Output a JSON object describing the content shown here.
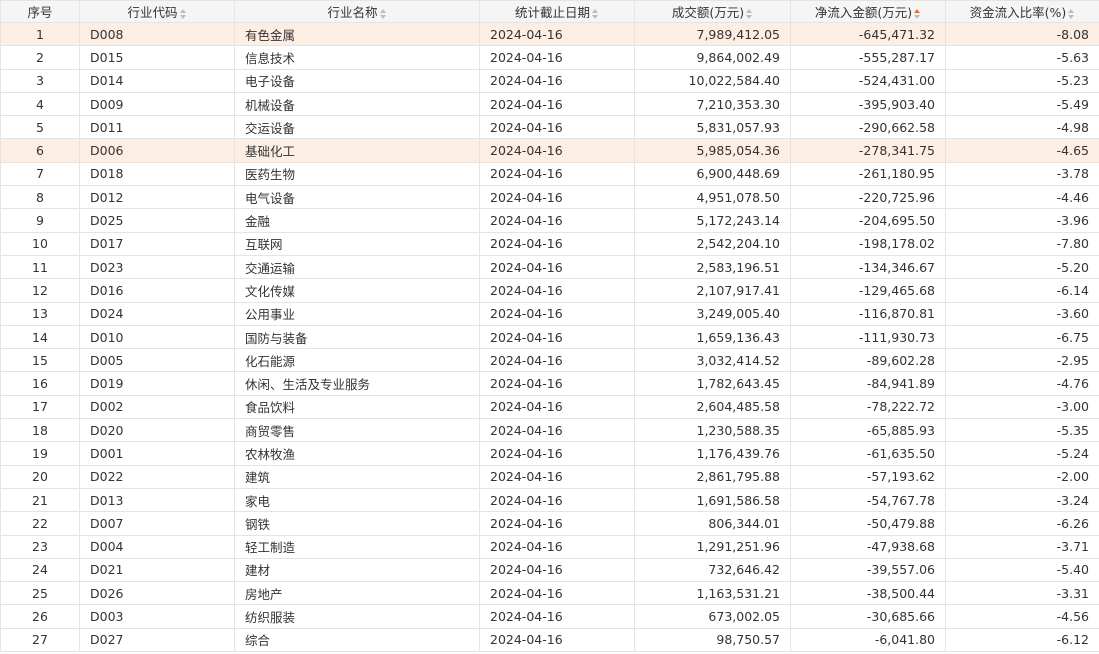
{
  "columns": {
    "seq": "序号",
    "code": "行业代码",
    "name": "行业名称",
    "date": "统计截止日期",
    "turnover": "成交额(万元)",
    "netflow": "净流入金额(万元)",
    "ratio": "资金流入比率(%)"
  },
  "sort": {
    "active_column": "netflow",
    "direction": "ascending",
    "active_color": "#f26b21"
  },
  "highlight_color": "#fdeee4",
  "rows": [
    {
      "seq": "1",
      "code": "D008",
      "name": "有色金属",
      "date": "2024-04-16",
      "turnover": "7,989,412.05",
      "netflow": "-645,471.32",
      "ratio": "-8.08",
      "highlighted": true
    },
    {
      "seq": "2",
      "code": "D015",
      "name": "信息技术",
      "date": "2024-04-16",
      "turnover": "9,864,002.49",
      "netflow": "-555,287.17",
      "ratio": "-5.63",
      "highlighted": false
    },
    {
      "seq": "3",
      "code": "D014",
      "name": "电子设备",
      "date": "2024-04-16",
      "turnover": "10,022,584.40",
      "netflow": "-524,431.00",
      "ratio": "-5.23",
      "highlighted": false
    },
    {
      "seq": "4",
      "code": "D009",
      "name": "机械设备",
      "date": "2024-04-16",
      "turnover": "7,210,353.30",
      "netflow": "-395,903.40",
      "ratio": "-5.49",
      "highlighted": false
    },
    {
      "seq": "5",
      "code": "D011",
      "name": "交运设备",
      "date": "2024-04-16",
      "turnover": "5,831,057.93",
      "netflow": "-290,662.58",
      "ratio": "-4.98",
      "highlighted": false
    },
    {
      "seq": "6",
      "code": "D006",
      "name": "基础化工",
      "date": "2024-04-16",
      "turnover": "5,985,054.36",
      "netflow": "-278,341.75",
      "ratio": "-4.65",
      "highlighted": true
    },
    {
      "seq": "7",
      "code": "D018",
      "name": "医药生物",
      "date": "2024-04-16",
      "turnover": "6,900,448.69",
      "netflow": "-261,180.95",
      "ratio": "-3.78",
      "highlighted": false
    },
    {
      "seq": "8",
      "code": "D012",
      "name": "电气设备",
      "date": "2024-04-16",
      "turnover": "4,951,078.50",
      "netflow": "-220,725.96",
      "ratio": "-4.46",
      "highlighted": false
    },
    {
      "seq": "9",
      "code": "D025",
      "name": "金融",
      "date": "2024-04-16",
      "turnover": "5,172,243.14",
      "netflow": "-204,695.50",
      "ratio": "-3.96",
      "highlighted": false
    },
    {
      "seq": "10",
      "code": "D017",
      "name": "互联网",
      "date": "2024-04-16",
      "turnover": "2,542,204.10",
      "netflow": "-198,178.02",
      "ratio": "-7.80",
      "highlighted": false
    },
    {
      "seq": "11",
      "code": "D023",
      "name": "交通运输",
      "date": "2024-04-16",
      "turnover": "2,583,196.51",
      "netflow": "-134,346.67",
      "ratio": "-5.20",
      "highlighted": false
    },
    {
      "seq": "12",
      "code": "D016",
      "name": "文化传媒",
      "date": "2024-04-16",
      "turnover": "2,107,917.41",
      "netflow": "-129,465.68",
      "ratio": "-6.14",
      "highlighted": false
    },
    {
      "seq": "13",
      "code": "D024",
      "name": "公用事业",
      "date": "2024-04-16",
      "turnover": "3,249,005.40",
      "netflow": "-116,870.81",
      "ratio": "-3.60",
      "highlighted": false
    },
    {
      "seq": "14",
      "code": "D010",
      "name": "国防与装备",
      "date": "2024-04-16",
      "turnover": "1,659,136.43",
      "netflow": "-111,930.73",
      "ratio": "-6.75",
      "highlighted": false
    },
    {
      "seq": "15",
      "code": "D005",
      "name": "化石能源",
      "date": "2024-04-16",
      "turnover": "3,032,414.52",
      "netflow": "-89,602.28",
      "ratio": "-2.95",
      "highlighted": false
    },
    {
      "seq": "16",
      "code": "D019",
      "name": "休闲、生活及专业服务",
      "date": "2024-04-16",
      "turnover": "1,782,643.45",
      "netflow": "-84,941.89",
      "ratio": "-4.76",
      "highlighted": false
    },
    {
      "seq": "17",
      "code": "D002",
      "name": "食品饮料",
      "date": "2024-04-16",
      "turnover": "2,604,485.58",
      "netflow": "-78,222.72",
      "ratio": "-3.00",
      "highlighted": false
    },
    {
      "seq": "18",
      "code": "D020",
      "name": "商贸零售",
      "date": "2024-04-16",
      "turnover": "1,230,588.35",
      "netflow": "-65,885.93",
      "ratio": "-5.35",
      "highlighted": false
    },
    {
      "seq": "19",
      "code": "D001",
      "name": "农林牧渔",
      "date": "2024-04-16",
      "turnover": "1,176,439.76",
      "netflow": "-61,635.50",
      "ratio": "-5.24",
      "highlighted": false
    },
    {
      "seq": "20",
      "code": "D022",
      "name": "建筑",
      "date": "2024-04-16",
      "turnover": "2,861,795.88",
      "netflow": "-57,193.62",
      "ratio": "-2.00",
      "highlighted": false
    },
    {
      "seq": "21",
      "code": "D013",
      "name": "家电",
      "date": "2024-04-16",
      "turnover": "1,691,586.58",
      "netflow": "-54,767.78",
      "ratio": "-3.24",
      "highlighted": false
    },
    {
      "seq": "22",
      "code": "D007",
      "name": "钢铁",
      "date": "2024-04-16",
      "turnover": "806,344.01",
      "netflow": "-50,479.88",
      "ratio": "-6.26",
      "highlighted": false
    },
    {
      "seq": "23",
      "code": "D004",
      "name": "轻工制造",
      "date": "2024-04-16",
      "turnover": "1,291,251.96",
      "netflow": "-47,938.68",
      "ratio": "-3.71",
      "highlighted": false
    },
    {
      "seq": "24",
      "code": "D021",
      "name": "建材",
      "date": "2024-04-16",
      "turnover": "732,646.42",
      "netflow": "-39,557.06",
      "ratio": "-5.40",
      "highlighted": false
    },
    {
      "seq": "25",
      "code": "D026",
      "name": "房地产",
      "date": "2024-04-16",
      "turnover": "1,163,531.21",
      "netflow": "-38,500.44",
      "ratio": "-3.31",
      "highlighted": false
    },
    {
      "seq": "26",
      "code": "D003",
      "name": "纺织服装",
      "date": "2024-04-16",
      "turnover": "673,002.05",
      "netflow": "-30,685.66",
      "ratio": "-4.56",
      "highlighted": false
    },
    {
      "seq": "27",
      "code": "D027",
      "name": "综合",
      "date": "2024-04-16",
      "turnover": "98,750.57",
      "netflow": "-6,041.80",
      "ratio": "-6.12",
      "highlighted": false
    }
  ]
}
